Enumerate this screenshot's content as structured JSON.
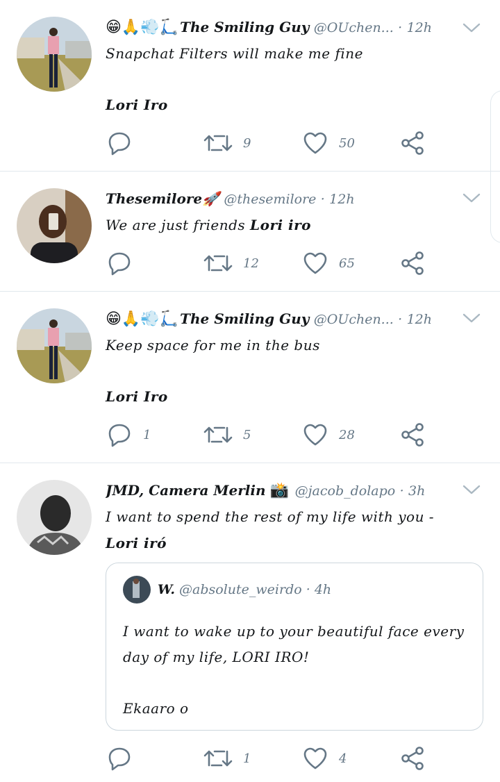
{
  "tweets": [
    {
      "emoji": "😁🙏💨🛴",
      "name": "The Smiling Guy",
      "handle": "@OUchen...",
      "time": "12h",
      "text_line1": "Snapchat Filters will make me fine",
      "text_line2": "Lori Iro",
      "reply_count": "",
      "retweet_count": "9",
      "like_count": "50"
    },
    {
      "emoji": "",
      "name": "Thesemilore🚀",
      "handle": "@thesemilore",
      "time": "12h",
      "text_plain": "We are just friends ",
      "text_bold": "Lori iro",
      "reply_count": "",
      "retweet_count": "12",
      "like_count": "65"
    },
    {
      "emoji": "😁🙏💨🛴",
      "name": "The Smiling Guy",
      "handle": "@OUchen...",
      "time": "12h",
      "text_line1": "Keep space for me in the bus",
      "text_line2": "Lori Iro",
      "reply_count": "1",
      "retweet_count": "5",
      "like_count": "28"
    },
    {
      "emoji": "📸",
      "name": "JMD, Camera Merlin",
      "handle": "@jacob_dolapo",
      "time": "3h",
      "text_plain": "I want to spend the rest of my life with you -",
      "text_bold": "Lori iró",
      "reply_count": "",
      "retweet_count": "1",
      "like_count": "4",
      "quote": {
        "name": "W.",
        "handle": "@absolute_weirdo",
        "time": "4h",
        "text": "I want to wake up to your beautiful face every day of my life, LORI IRO!\n\nEkaaro o"
      }
    }
  ],
  "separator": "·",
  "icons": [
    "reply-icon",
    "retweet-icon",
    "like-icon",
    "share-icon",
    "caret-down-icon"
  ],
  "colors": {
    "icon": "#657786",
    "border": "#e1e8ed",
    "text": "#14171a"
  }
}
